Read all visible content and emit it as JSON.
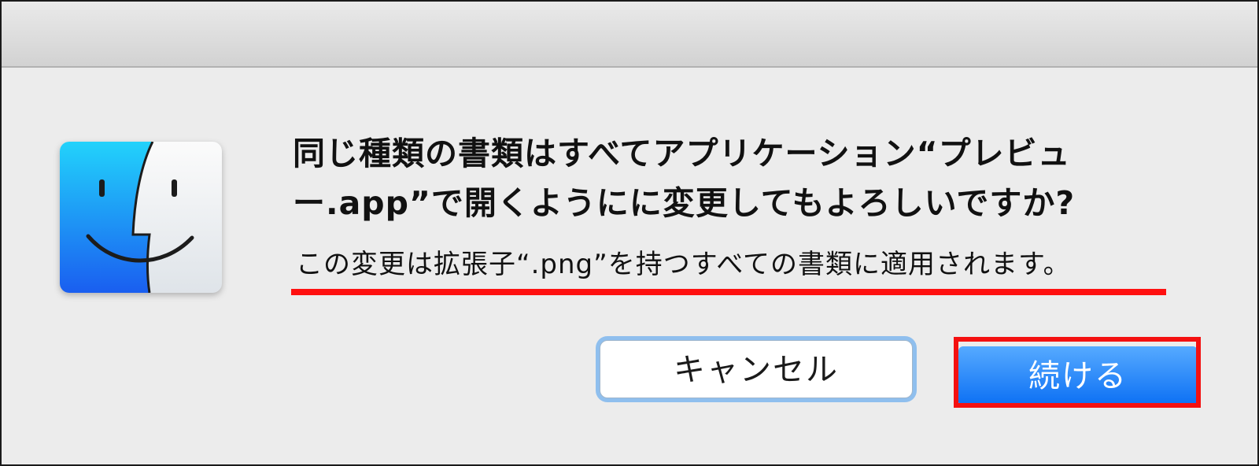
{
  "dialog": {
    "icon": "finder-icon",
    "title": "同じ種類の書類はすべてアプリケーション“プレビュー.app”で開くようにに変更してもよろしいですか?",
    "info": "この変更は拡張子“.png”を持つすべての書類に適用されます。",
    "buttons": {
      "cancel": "キャンセル",
      "continue": "続ける"
    }
  },
  "colors": {
    "highlight": "#ff1010",
    "default_button": "#1a7df8",
    "focus_ring": "#8fbfee"
  }
}
